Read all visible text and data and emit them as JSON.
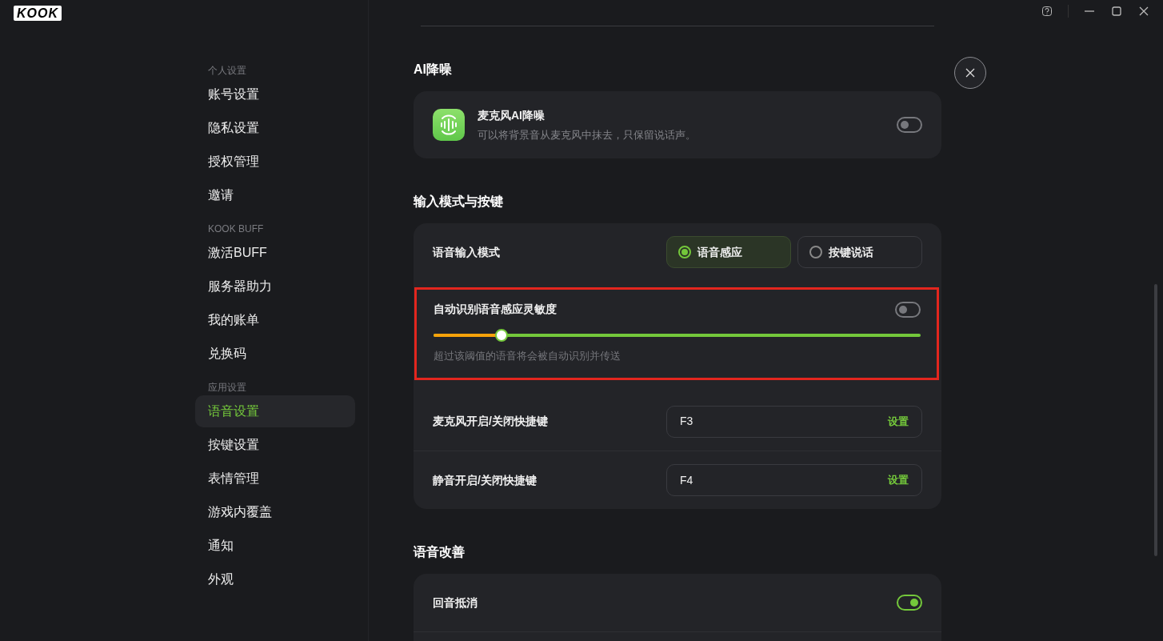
{
  "app": {
    "logo": "KOOK"
  },
  "title_bar": {
    "buttons": [
      {
        "kind": "help"
      },
      {
        "kind": "minimize"
      },
      {
        "kind": "maximize"
      },
      {
        "kind": "close"
      }
    ]
  },
  "sidebar": {
    "groups": [
      {
        "header": "个人设置",
        "items": [
          {
            "label": "账号设置",
            "selected": false
          },
          {
            "label": "隐私设置",
            "selected": false
          },
          {
            "label": "授权管理",
            "selected": false
          },
          {
            "label": "邀请",
            "selected": false
          }
        ]
      },
      {
        "header": "KOOK BUFF",
        "items": [
          {
            "label": "激活BUFF",
            "selected": false
          },
          {
            "label": "服务器助力",
            "selected": false
          },
          {
            "label": "我的账单",
            "selected": false
          },
          {
            "label": "兑换码",
            "selected": false
          }
        ]
      },
      {
        "header": "应用设置",
        "items": [
          {
            "label": "语音设置",
            "selected": true
          },
          {
            "label": "按键设置",
            "selected": false
          },
          {
            "label": "表情管理",
            "selected": false
          },
          {
            "label": "游戏内覆盖",
            "selected": false
          },
          {
            "label": "通知",
            "selected": false
          },
          {
            "label": "外观",
            "selected": false
          }
        ]
      }
    ]
  },
  "sections": [
    {
      "title": "AI降噪",
      "rows": [
        {
          "kind": "feature",
          "title": "麦克风AI降噪",
          "description": "可以将背景音从麦克风中抹去，只保留说话声。",
          "on": false
        }
      ]
    },
    {
      "title": "输入模式与按键",
      "rows": [
        {
          "kind": "choice",
          "label": "语音输入模式",
          "options": [
            {
              "label": "语音感应",
              "selected": true
            },
            {
              "label": "按键说话",
              "selected": false
            }
          ]
        },
        {
          "kind": "slider",
          "label": "自动识别语音感应灵敏度",
          "on": false,
          "level": 0.14,
          "hint": "超过该阈值的语音将会被自动识别并传送",
          "highlighted": true
        },
        {
          "kind": "hotkey",
          "label": "麦克风开启/关闭快捷键",
          "value": "F3",
          "action": "设置"
        },
        {
          "kind": "hotkey",
          "label": "静音开启/关闭快捷键",
          "value": "F4",
          "action": "设置"
        }
      ]
    },
    {
      "title": "语音改善",
      "rows": [
        {
          "kind": "toggle",
          "label": "回音抵消",
          "on": true
        },
        {
          "kind": "blank"
        }
      ]
    }
  ]
}
